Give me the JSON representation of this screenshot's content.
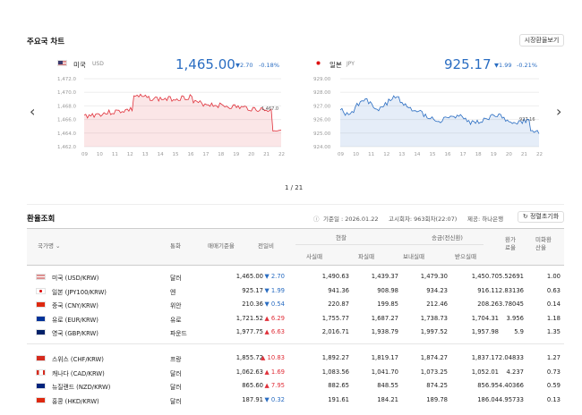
{
  "header": {
    "title": "주요국 차트",
    "right_button": "시장환율보기"
  },
  "charts": [
    {
      "country": "미국",
      "code": "USD",
      "value": "1,465.00",
      "change": "▼2.70",
      "pct": "-0.18%",
      "y_ticks": [
        "1,472.0",
        "1,470.0",
        "1,468.0",
        "1,466.0",
        "1,464.0",
        "1,462.0"
      ],
      "x_ticks": [
        "09",
        "10",
        "11",
        "12",
        "13",
        "14",
        "15",
        "16",
        "17",
        "18",
        "19",
        "20",
        "21",
        "22"
      ],
      "last_label": "1,467.0",
      "color": "#e0303a"
    },
    {
      "country": "일본",
      "code": "JPY",
      "value": "925.17",
      "change": "▼1.99",
      "pct": "-0.21%",
      "y_ticks": [
        "929.00",
        "928.00",
        "927.00",
        "926.00",
        "925.00",
        "924.00"
      ],
      "x_ticks": [
        "09",
        "10",
        "11",
        "12",
        "13",
        "14",
        "15",
        "16",
        "17",
        "18",
        "19",
        "20",
        "21",
        "22"
      ],
      "last_label": "927.16",
      "color": "#2a6dc2"
    }
  ],
  "pager": "1 / 21",
  "section2": {
    "title": "환율조회",
    "base_date": "기준일 : 2026.01.22",
    "notice": "고시회차: 963회차(22:07)",
    "source": "제공: 하나은행",
    "reset_button": "정렬초기화"
  },
  "table": {
    "headers": {
      "country": "국가명",
      "currency": "통화",
      "base_rate": "매매기준율",
      "change": "전일비",
      "cash": "현찰",
      "cash_buy": "사실때",
      "cash_sell": "파실때",
      "transfer": "송금(전신환)",
      "send": "보내실때",
      "receive": "받으실때",
      "exchange_ratio": "환가료율",
      "usd_ratio": "미화환산율"
    },
    "group1": [
      {
        "name": "미국 (USD/KRW)",
        "cur": "달러",
        "base": "1,465.00",
        "dir": "down",
        "chg": "2.70",
        "buy": "1,490.63",
        "sell": "1,439.37",
        "send": "1,479.30",
        "recv": "1,450.70",
        "fee": "5.52691",
        "usd": "1.00",
        "flag": "us"
      },
      {
        "name": "일본 (JPY100/KRW)",
        "cur": "엔",
        "base": "925.17",
        "dir": "down",
        "chg": "1.99",
        "buy": "941.36",
        "sell": "908.98",
        "send": "934.23",
        "recv": "916.11",
        "fee": "2.83136",
        "usd": "0.63",
        "flag": "jp"
      },
      {
        "name": "중국 (CNY/KRW)",
        "cur": "위안",
        "base": "210.36",
        "dir": "down",
        "chg": "0.54",
        "buy": "220.87",
        "sell": "199.85",
        "send": "212.46",
        "recv": "208.26",
        "fee": "3.78045",
        "usd": "0.14",
        "flag": "cn"
      },
      {
        "name": "유로 (EUR/KRW)",
        "cur": "유로",
        "base": "1,721.52",
        "dir": "up",
        "chg": "6.29",
        "buy": "1,755.77",
        "sell": "1,687.27",
        "send": "1,738.73",
        "recv": "1,704.31",
        "fee": "3.956",
        "usd": "1.18",
        "flag": "eu"
      },
      {
        "name": "영국 (GBP/KRW)",
        "cur": "파운드",
        "base": "1,977.75",
        "dir": "up",
        "chg": "6.63",
        "buy": "2,016.71",
        "sell": "1,938.79",
        "send": "1,997.52",
        "recv": "1,957.98",
        "fee": "5.9",
        "usd": "1.35",
        "flag": "gb"
      }
    ],
    "group2": [
      {
        "name": "스위스 (CHF/KRW)",
        "cur": "프랑",
        "base": "1,855.72",
        "dir": "up",
        "chg": "10.83",
        "buy": "1,892.27",
        "sell": "1,819.17",
        "send": "1,874.27",
        "recv": "1,837.17",
        "fee": "2.04833",
        "usd": "1.27",
        "flag": "ch"
      },
      {
        "name": "캐나다 (CAD/KRW)",
        "cur": "달러",
        "base": "1,062.63",
        "dir": "up",
        "chg": "1.69",
        "buy": "1,083.56",
        "sell": "1,041.70",
        "send": "1,073.25",
        "recv": "1,052.01",
        "fee": "4.237",
        "usd": "0.73",
        "flag": "ca"
      },
      {
        "name": "뉴질랜드 (NZD/KRW)",
        "cur": "달러",
        "base": "865.60",
        "dir": "up",
        "chg": "7.95",
        "buy": "882.65",
        "sell": "848.55",
        "send": "874.25",
        "recv": "856.95",
        "fee": "4.40366",
        "usd": "0.59",
        "flag": "nz"
      },
      {
        "name": "홍콩 (HKD/KRW)",
        "cur": "달러",
        "base": "187.91",
        "dir": "down",
        "chg": "0.32",
        "buy": "191.61",
        "sell": "184.21",
        "send": "189.78",
        "recv": "186.04",
        "fee": "4.95733",
        "usd": "0.13",
        "flag": "hk"
      }
    ]
  },
  "icons": {
    "left": "chevron-left-icon",
    "right": "chevron-right-icon",
    "info": "info-icon",
    "refresh": "refresh-icon",
    "sort": "sort-icon"
  }
}
